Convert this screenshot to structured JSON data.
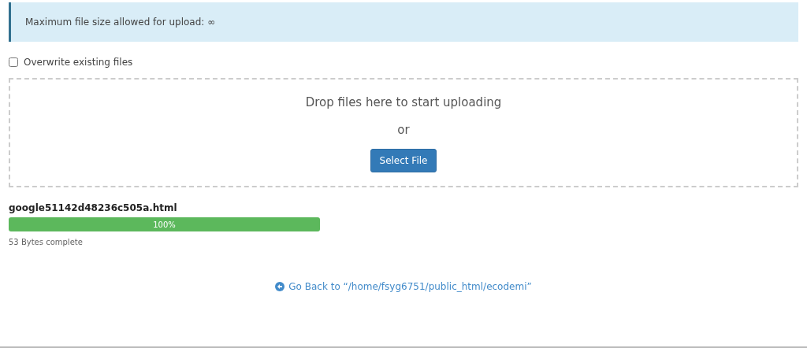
{
  "notice": {
    "text": "Maximum file size allowed for upload: ∞"
  },
  "overwrite": {
    "label": "Overwrite existing files",
    "checked": false
  },
  "dropzone": {
    "prompt": "Drop files here to start uploading",
    "separator": "or",
    "button": "Select File"
  },
  "uploads": [
    {
      "name": "google51142d48236c505a.html",
      "level": 1,
      "reading": "100%",
      "status": "53 Bytes complete"
    }
  ],
  "back_link": {
    "text": "Go Back to “/home/fsyg6751/public_html/ecodemi”"
  }
}
